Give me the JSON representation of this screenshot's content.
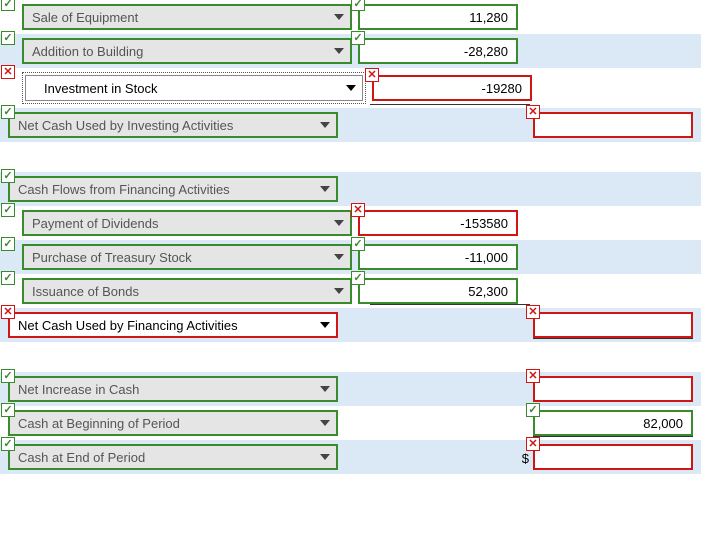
{
  "rows": {
    "saleEquip": {
      "label": "Sale of Equipment",
      "value": "11,280"
    },
    "addBuilding": {
      "label": "Addition to Building",
      "value": "-28,280"
    },
    "investStock": {
      "label": "Investment in Stock",
      "value": "-19280"
    },
    "netInvest": {
      "label": "Net Cash Used by Investing Activities"
    },
    "finHeader": {
      "label": "Cash Flows from Financing Activities"
    },
    "payDiv": {
      "label": "Payment of Dividends",
      "value": "-153580"
    },
    "treasury": {
      "label": "Purchase of Treasury Stock",
      "value": "-11,000"
    },
    "bonds": {
      "label": "Issuance of Bonds",
      "value": "52,300"
    },
    "netFin": {
      "label": "Net Cash Used by Financing Activities"
    },
    "netInc": {
      "label": "Net Increase in Cash"
    },
    "cashBeg": {
      "label": "Cash at Beginning of Period",
      "value": "82,000"
    },
    "cashEnd": {
      "label": "Cash at End of Period"
    }
  },
  "dollarSign": "$"
}
